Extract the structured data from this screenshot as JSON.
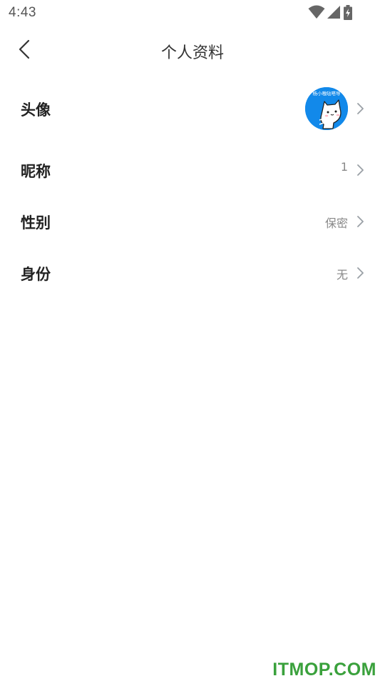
{
  "status_bar": {
    "time": "4:43",
    "icons": [
      "wifi-icon",
      "cellular-signal-icon",
      "battery-charging-icon"
    ]
  },
  "header": {
    "title": "个人资料",
    "back_icon": "chevron-left-icon"
  },
  "profile_rows": [
    {
      "label": "头像",
      "value": "",
      "type": "avatar",
      "avatar_caption": "杨小嗷哒嗒导"
    },
    {
      "label": "昵称",
      "value": "1"
    },
    {
      "label": "性别",
      "value": "保密"
    },
    {
      "label": "身份",
      "value": "无"
    }
  ],
  "watermark": "ITMOP.COM",
  "colors": {
    "avatar_bg": "#1289ea",
    "watermark": "#3aa13c",
    "chevron": "#9aa0a6",
    "value_text": "#888888"
  }
}
